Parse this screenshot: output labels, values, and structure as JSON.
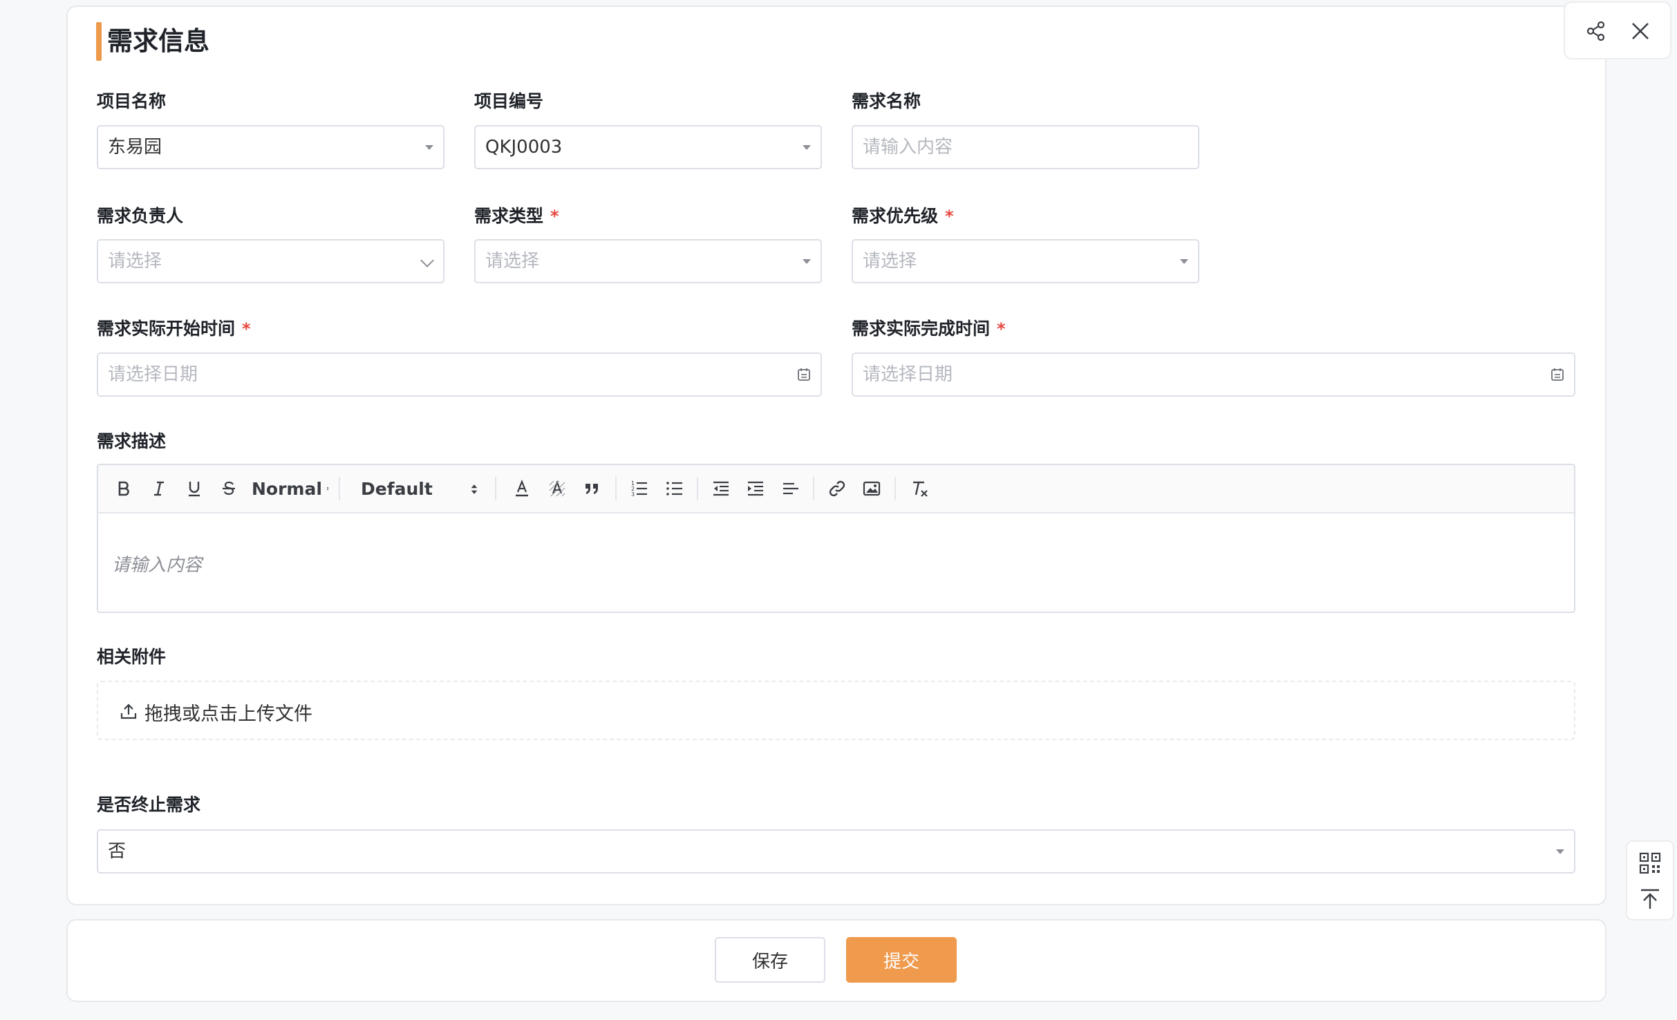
{
  "section": {
    "title": "需求信息"
  },
  "form": {
    "project_name": {
      "label": "项目名称",
      "value": "东易园"
    },
    "project_code": {
      "label": "项目编号",
      "value": "QKJ0003"
    },
    "req_name": {
      "label": "需求名称",
      "placeholder": "请输入内容"
    },
    "req_owner": {
      "label": "需求负责人",
      "placeholder": "请选择"
    },
    "req_type": {
      "label": "需求类型",
      "required_mark": "*",
      "placeholder": "请选择"
    },
    "req_priority": {
      "label": "需求优先级",
      "required_mark": "*",
      "placeholder": "请选择"
    },
    "actual_start": {
      "label": "需求实际开始时间",
      "required_mark": "*",
      "placeholder": "请选择日期"
    },
    "actual_end": {
      "label": "需求实际完成时间",
      "required_mark": "*",
      "placeholder": "请选择日期"
    },
    "description": {
      "label": "需求描述",
      "placeholder": "请输入内容",
      "toolbar": {
        "size": "Normal",
        "font": "Default"
      }
    },
    "attachments": {
      "label": "相关附件",
      "upload_text": "拖拽或点击上传文件"
    },
    "terminate": {
      "label": "是否终止需求",
      "value": "否"
    }
  },
  "actions": {
    "save": "保存",
    "submit": "提交"
  },
  "colors": {
    "accent": "#ef9a4c",
    "required": "#e5483d",
    "border": "#dcdfe6"
  }
}
